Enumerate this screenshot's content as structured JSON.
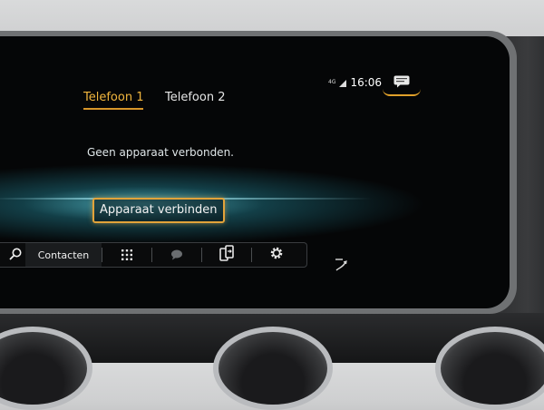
{
  "status": {
    "network": "4G",
    "time": "16:06"
  },
  "tabs": [
    {
      "label": "Telefoon 1",
      "active": true
    },
    {
      "label": "Telefoon 2",
      "active": false
    }
  ],
  "message": "Geen apparaat verbonden.",
  "connect_button": "Apparaat verbinden",
  "toolbar": {
    "search_icon": "search-icon",
    "contacts_label": "Contacten",
    "keypad_icon": "keypad-icon",
    "messages_icon": "speech-bubble-icon",
    "devices_icon": "phone-transfer-icon",
    "settings_icon": "gear-icon"
  },
  "colors": {
    "accent": "#e2a33a",
    "glow": "#54becd",
    "screen_bg": "#050607"
  }
}
